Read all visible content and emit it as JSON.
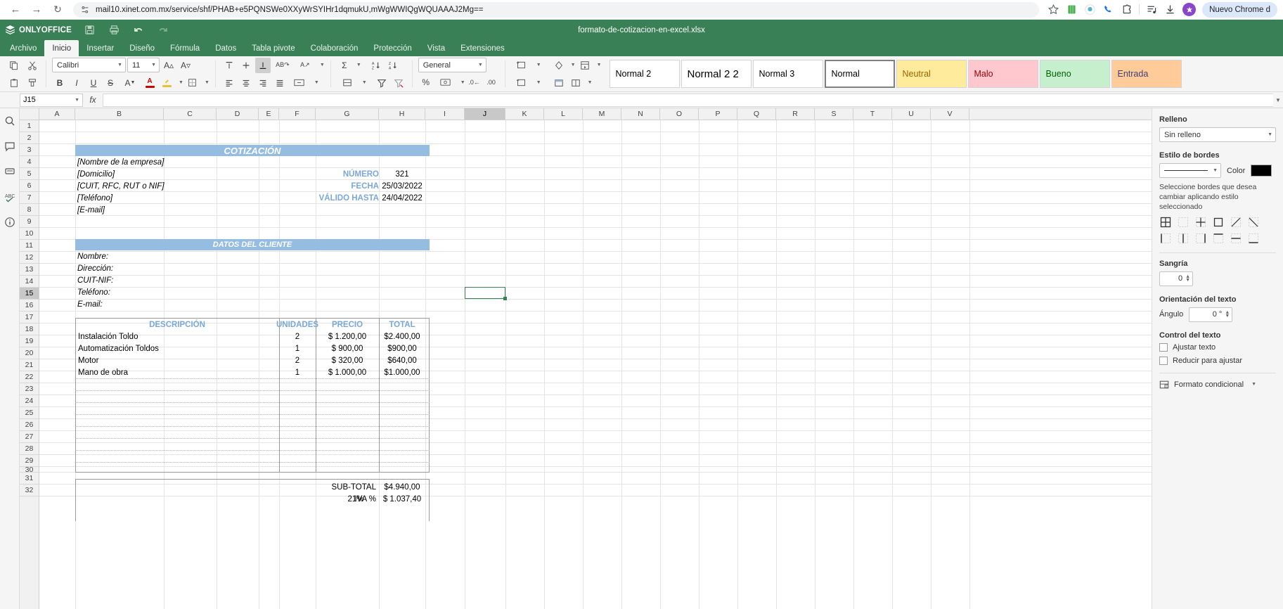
{
  "browser": {
    "url": "mail10.xinet.com.mx/service/shf/PHAB+e5PQNSWe0XXyWrSYIHr1dqmukU,mWgWWIQgWQUAAAJ2Mg==",
    "back_icon": "back-arrow-icon",
    "forward_icon": "forward-arrow-icon",
    "reload_icon": "reload-icon",
    "tune_icon": "page-settings-icon",
    "bookmark_icon": "star-icon",
    "chrome_pill": "Nuevo Chrome d"
  },
  "app": {
    "brand": "ONLYOFFICE",
    "document_title": "formato-de-cotizacion-en-excel.xlsx",
    "quick_access": [
      "save-icon",
      "print-icon",
      "undo-icon",
      "redo-icon"
    ],
    "tabs": [
      {
        "label": "Archivo",
        "active": false
      },
      {
        "label": "Inicio",
        "active": true
      },
      {
        "label": "Insertar",
        "active": false
      },
      {
        "label": "Diseño",
        "active": false
      },
      {
        "label": "Fórmula",
        "active": false
      },
      {
        "label": "Datos",
        "active": false
      },
      {
        "label": "Tabla pivote",
        "active": false
      },
      {
        "label": "Colaboración",
        "active": false
      },
      {
        "label": "Protección",
        "active": false
      },
      {
        "label": "Vista",
        "active": false
      },
      {
        "label": "Extensiones",
        "active": false
      }
    ]
  },
  "ribbon": {
    "font_name": "Calibri",
    "font_size": "11",
    "number_format": "General",
    "styles": [
      {
        "label": "Normal 2",
        "bg": "#ffffff",
        "fg": "#000000",
        "selected": false
      },
      {
        "label": "Normal 2 2",
        "bg": "#ffffff",
        "fg": "#000000",
        "selected": false
      },
      {
        "label": "Normal 3",
        "bg": "#ffffff",
        "fg": "#000000",
        "selected": false
      },
      {
        "label": "Normal",
        "bg": "#ffffff",
        "fg": "#000000",
        "selected": true
      },
      {
        "label": "Neutral",
        "bg": "#ffeb9c",
        "fg": "#9c6500",
        "selected": false
      },
      {
        "label": "Malo",
        "bg": "#ffc7ce",
        "fg": "#9c0006",
        "selected": false
      },
      {
        "label": "Bueno",
        "bg": "#c6efce",
        "fg": "#006100",
        "selected": false
      },
      {
        "label": "Entrada",
        "bg": "#ffcc99",
        "fg": "#3f3f76",
        "selected": false
      }
    ]
  },
  "formula_bar": {
    "name_box": "J15",
    "fx_label": "fx",
    "formula_value": ""
  },
  "grid": {
    "columns": [
      "A",
      "B",
      "C",
      "D",
      "E",
      "F",
      "G",
      "H",
      "I",
      "J",
      "K",
      "L",
      "M",
      "N",
      "O",
      "P",
      "Q",
      "R",
      "S",
      "T",
      "U",
      "V"
    ],
    "selected_column": "J",
    "selected_row": "15",
    "rows": [
      "1",
      "2",
      "3",
      "4",
      "5",
      "6",
      "7",
      "8",
      "9",
      "10",
      "11",
      "12",
      "13",
      "14",
      "15",
      "16",
      "17",
      "18",
      "19",
      "20",
      "21",
      "22",
      "23",
      "24",
      "25",
      "26",
      "27",
      "28",
      "29",
      "30",
      "31",
      "32"
    ],
    "selection_ref": "J15"
  },
  "document": {
    "title_band": "COTIZACIÓN",
    "company_lines": [
      "[Nombre de la empresa]",
      "[Domicilio]",
      "[CUIT, RFC, RUT o NIF]",
      "[Teléfono]",
      "[E-mail]"
    ],
    "meta": [
      {
        "label": "NÚMERO",
        "value": "321"
      },
      {
        "label": "FECHA",
        "value": "25/03/2022"
      },
      {
        "label": "VÁLIDO HASTA",
        "value": "24/04/2022"
      }
    ],
    "client_band": "DATOS DEL CLIENTE",
    "client_fields": [
      "Nombre:",
      "Dirección:",
      "CUIT-NIF:",
      "Teléfono:",
      "E-mail:"
    ],
    "table_headers": [
      "DESCRIPCIÓN",
      "UNIDADES",
      "PRECIO",
      "TOTAL"
    ],
    "items": [
      {
        "descripcion": "Instalación Toldo",
        "unidades": "2",
        "precio": "$ 1.200,00",
        "total": "$2.400,00"
      },
      {
        "descripcion": "Automatización Toldos",
        "unidades": "1",
        "precio": "$ 900,00",
        "total": "$900,00"
      },
      {
        "descripcion": "Motor",
        "unidades": "2",
        "precio": "$ 320,00",
        "total": "$640,00"
      },
      {
        "descripcion": "Mano de obra",
        "unidades": "1",
        "precio": "$ 1.000,00",
        "total": "$1.000,00"
      }
    ],
    "totals": [
      {
        "label": "SUB-TOTAL",
        "rate": "",
        "value": "$4.940,00"
      },
      {
        "label": "IVA %",
        "rate": "21%",
        "value": "$ 1.037,40"
      }
    ]
  },
  "sidebar": {
    "fill_heading": "Relleno",
    "fill_value": "Sin relleno",
    "border_style_heading": "Estilo de bordes",
    "color_label": "Color",
    "border_color": "#000000",
    "border_note": "Seleccione bordes que desea cambiar aplicando estilo seleccionado",
    "indent_heading": "Sangría",
    "indent_value": "0",
    "orientation_heading": "Orientación del texto",
    "angle_label": "Ángulo",
    "angle_value": "0 °",
    "text_control_heading": "Control del texto",
    "wrap_label": "Ajustar texto",
    "shrink_label": "Reducir para ajustar",
    "conditional_label": "Formato condicional"
  }
}
